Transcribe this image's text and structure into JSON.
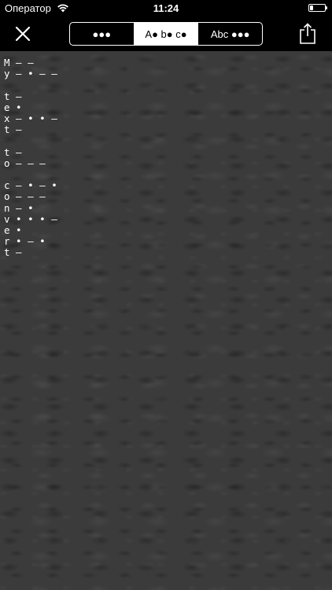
{
  "status_bar": {
    "carrier": "Оператор",
    "time": "11:24",
    "battery_level": 0.2
  },
  "nav": {
    "segments": [
      {
        "label": "●●●",
        "selected": false
      },
      {
        "label": "A● b● c●",
        "selected": true
      },
      {
        "label": "Abc ●●●",
        "selected": false
      }
    ]
  },
  "morse_lines": [
    "M — —",
    "y — • — —",
    "",
    "t —",
    "e •",
    "x — • • —",
    "t —",
    "",
    "t —",
    "o — — —",
    "",
    "c — • — •",
    "o — — —",
    "n — •",
    "v • • • —",
    "e •",
    "r • — •",
    "t —"
  ]
}
